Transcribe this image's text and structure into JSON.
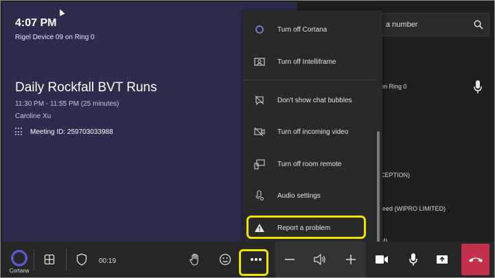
{
  "meeting": {
    "time": "4:07 PM",
    "device": "Rigel Device 09 on Ring 0",
    "title": "Daily Rockfall BVT Runs",
    "schedule": "11:30 PM - 11:55 PM (25 minutes)",
    "organizer": "Caroline Xu",
    "meeting_id": "Meeting ID: 259703033988"
  },
  "right_panel": {
    "search_partial": "a number",
    "partial_texts": [
      "on Ring 0",
      "CEPTION)",
      "reed (WIPRO LIMITED)",
      "M)"
    ]
  },
  "menu": {
    "items": [
      {
        "label": "Turn off Cortana",
        "icon": "cortana-circle-icon"
      },
      {
        "label": "Turn off Intelliframe",
        "icon": "intelliframe-icon"
      },
      {
        "label": "Don't show chat bubbles",
        "icon": "chat-bubble-off-icon"
      },
      {
        "label": "Turn off incoming video",
        "icon": "video-off-icon"
      },
      {
        "label": "Turn off room remote",
        "icon": "room-remote-icon"
      },
      {
        "label": "Audio settings",
        "icon": "audio-settings-icon"
      },
      {
        "label": "Report a problem",
        "icon": "warning-icon"
      }
    ]
  },
  "bottombar": {
    "cortana_label": "Cortana",
    "timer": "00:19"
  },
  "colors": {
    "meeting_bg": "#2d2c4d",
    "accent_purple": "#5b5fc7",
    "highlight_yellow": "#f4e300",
    "hangup_red": "#c4314b"
  }
}
